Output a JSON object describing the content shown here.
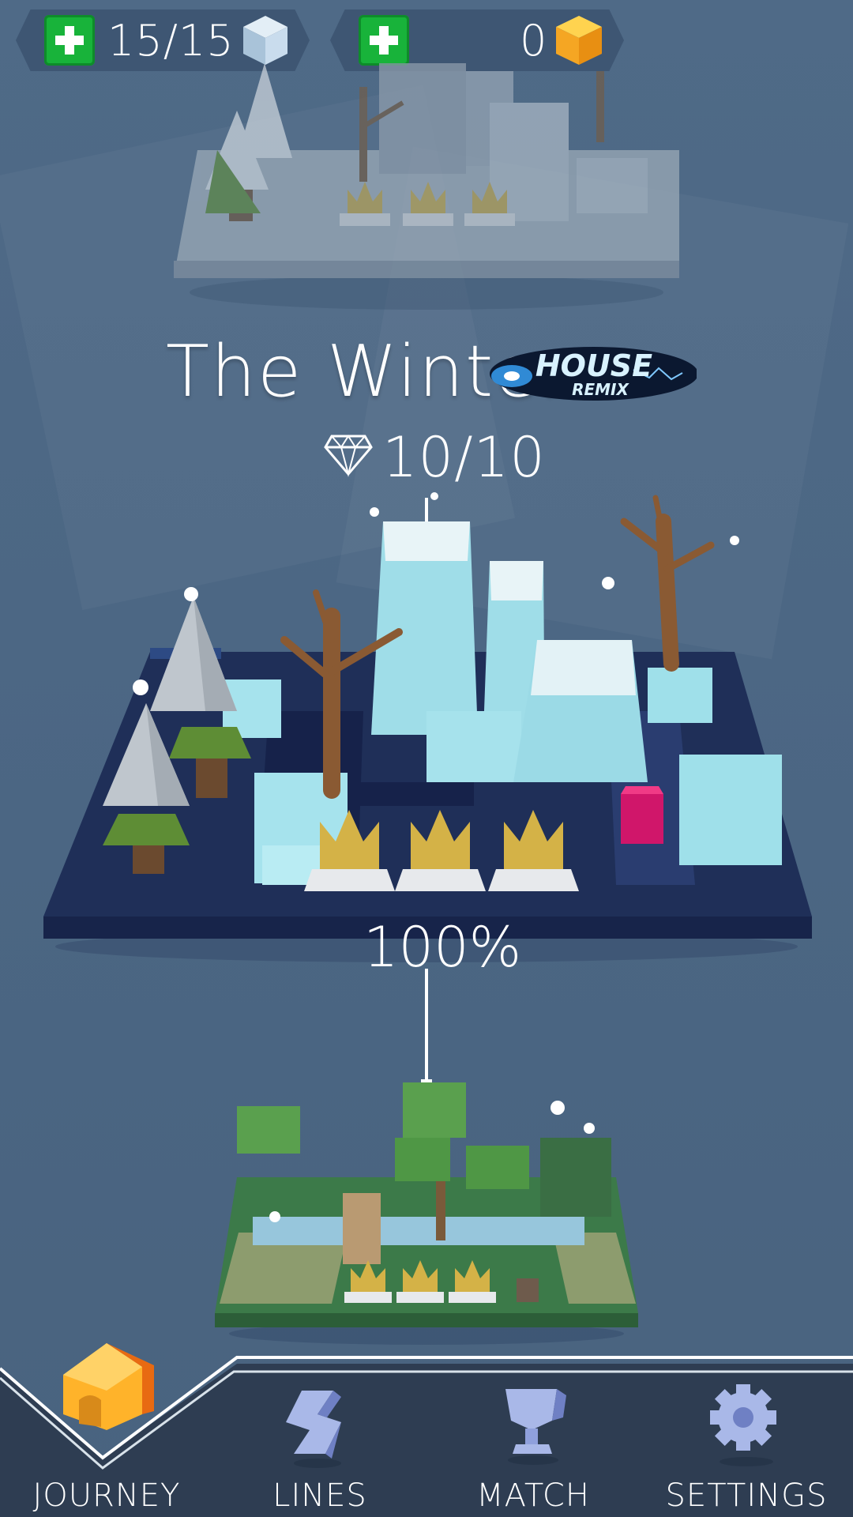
{
  "top_bar": {
    "cubes": {
      "value": "15/15",
      "icon": "ice-cube-icon",
      "add_icon": "plus-icon"
    },
    "coins": {
      "value": "0",
      "icon": "gold-cube-icon",
      "add_icon": "plus-icon"
    }
  },
  "level": {
    "title": "The Winter",
    "badge_main": "HOUSE",
    "badge_sub": "REMIX",
    "gems": "10/10",
    "gem_icon": "diamond-icon",
    "progress": "100%"
  },
  "tabs": [
    {
      "label": "JOURNEY",
      "icon": "house-icon",
      "selected": true
    },
    {
      "label": "LINES",
      "icon": "lines-icon",
      "selected": false
    },
    {
      "label": "MATCH",
      "icon": "trophy-icon",
      "selected": false
    },
    {
      "label": "SETTINGS",
      "icon": "gear-icon",
      "selected": false
    }
  ],
  "colors": {
    "background": "#4e6986",
    "tab_bar": "#2e3d52",
    "plus_green": "#18b33a",
    "gold": "#f7b52b",
    "board_navy": "#1f2f58",
    "ice": "#9ee1ea"
  }
}
